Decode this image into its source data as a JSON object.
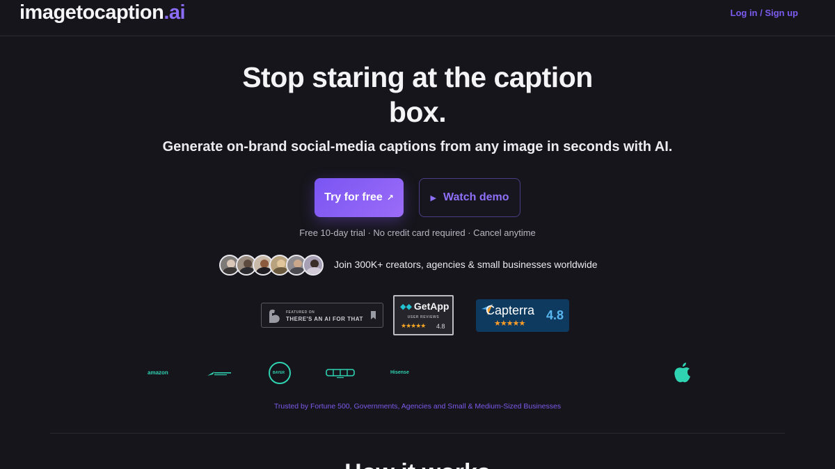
{
  "header": {
    "logo_main": "imagetocaption",
    "logo_suffix": ".ai",
    "login_label": "Log in / Sign up"
  },
  "hero": {
    "title_line1": "Stop staring at the caption",
    "title_line2": "box.",
    "subtitle": "Generate on-brand social-media captions from any image in seconds with AI.",
    "try_label": "Try for free",
    "try_icon": "arrow-up-right-icon",
    "demo_label": "Watch demo",
    "demo_icon": "play-icon",
    "trial_note": "Free 10-day trial · No credit card required · Cancel anytime"
  },
  "social_proof": {
    "join_text": "Join 300K+ creators, agencies & small businesses worldwide",
    "avatar_count": 6
  },
  "badges": {
    "aift": {
      "small": "FEATURED ON",
      "big": "THERE'S AN AI FOR THAT"
    },
    "getapp": {
      "name": "GetApp",
      "sub": "USER REVIEWS",
      "stars": "★★★★★",
      "score": "4.8"
    },
    "capterra": {
      "name": "Capterra",
      "stars": "★★★★★",
      "score": "4.8"
    }
  },
  "clients": {
    "amazon": "amazon",
    "bayer": "BAYER",
    "hisense": "Hisense"
  },
  "trusted_text": "Trusted by Fortune 500, Governments, Agencies and Small & Medium-Sized Businesses",
  "next_section_heading": "How it works",
  "colors": {
    "background": "#16151b",
    "accent": "#8b6cf6",
    "client_logo": "#2fd3b2",
    "capterra_bg": "#0f3a5f"
  }
}
